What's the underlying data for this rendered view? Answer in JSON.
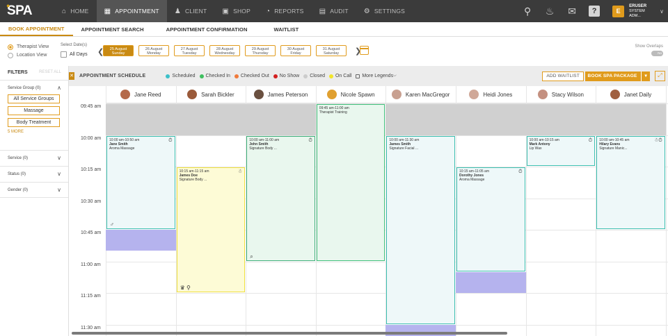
{
  "app": {
    "logo": "SPA"
  },
  "nav": [
    {
      "label": "HOME",
      "icon": "home-icon",
      "glyph": "⌂",
      "active": false
    },
    {
      "label": "APPOINTMENT",
      "icon": "calendar-icon",
      "glyph": "▦",
      "active": true
    },
    {
      "label": "CLIENT",
      "icon": "client-icon",
      "glyph": "♟",
      "active": false
    },
    {
      "label": "SHOP",
      "icon": "shop-icon",
      "glyph": "▣",
      "active": false
    },
    {
      "label": "REPORTS",
      "icon": "reports-icon",
      "glyph": "◔",
      "active": false
    },
    {
      "label": "AUDIT",
      "icon": "audit-icon",
      "glyph": "▤",
      "active": false
    },
    {
      "label": "SETTINGS",
      "icon": "settings-icon",
      "glyph": "⚙",
      "active": false
    }
  ],
  "user": {
    "initial": "E",
    "name": "ERUSER",
    "role": "SYSTEM ADM..."
  },
  "subtabs": [
    "BOOK APPOINTMENT",
    "APPOINTMENT SEARCH",
    "APPOINTMENT CONFIRMATION",
    "WAITLIST"
  ],
  "datebar": {
    "therapist_view": "Therapist View",
    "location_view": "Location View",
    "select_dates": "Select Date(s)",
    "all_days": "All Days",
    "show_overlaps": "Show Overlaps",
    "toggle": "No",
    "dates": [
      {
        "date": "25 August",
        "day": "Sunday",
        "selected": true
      },
      {
        "date": "26 August",
        "day": "Monday",
        "selected": false
      },
      {
        "date": "27 August",
        "day": "Tuesday",
        "selected": false
      },
      {
        "date": "28 August",
        "day": "Wednesday",
        "selected": false
      },
      {
        "date": "29 August",
        "day": "Thursday",
        "selected": false
      },
      {
        "date": "30 August",
        "day": "Friday",
        "selected": false
      },
      {
        "date": "31 August",
        "day": "Saturday",
        "selected": false
      }
    ]
  },
  "filters": {
    "title": "FILTERS",
    "reset": "RESET ALL",
    "service_group": "Service Group (0)",
    "groups": [
      "All Service Groups",
      "Massage",
      "Body Treatment"
    ],
    "more": "5 MORE",
    "service": "Service (0)",
    "status": "Status (0)",
    "gender": "Gender (0)"
  },
  "schedule": {
    "title": "APPOINTMENT SCHEDULE",
    "legend": [
      {
        "label": "Scheduled",
        "color": "#3cc0c9"
      },
      {
        "label": "Checked In",
        "color": "#3fbf5f"
      },
      {
        "label": "Checked Out",
        "color": "#f07a3a"
      },
      {
        "label": "No Show",
        "color": "#d32020"
      },
      {
        "label": "Closed",
        "color": "#cccccc"
      },
      {
        "label": "On Call",
        "color": "#f2e52a"
      }
    ],
    "more_legends": "More Legends",
    "add_waitlist": "ADD WAITLIST",
    "book_package": "BOOK SPA PACKAGE"
  },
  "therapists": [
    {
      "name": "Jane Reed",
      "avatar": "#b46a4a"
    },
    {
      "name": "Sarah Bickler",
      "avatar": "#9a5a3a"
    },
    {
      "name": "James Peterson",
      "avatar": "#6a5040"
    },
    {
      "name": "Nicole Spawn",
      "avatar": "#e0a030"
    },
    {
      "name": "Karen MacGregor",
      "avatar": "#c8a090"
    },
    {
      "name": "Heidi Jones",
      "avatar": "#d0a898"
    },
    {
      "name": "Stacy Wilson",
      "avatar": "#c49080"
    },
    {
      "name": "Janet Daily",
      "avatar": "#a06040"
    }
  ],
  "times": [
    "09:45 am",
    "10:00 am",
    "10:15 am",
    "10:30 am",
    "10:45 am",
    "11:00 am",
    "11:15 am",
    "11:30 am"
  ],
  "appointments": [
    {
      "col": 0,
      "start": 1,
      "span": 3,
      "time": "10:00 am-10:50 am",
      "client": "Jane Smith",
      "service": "Aroma Massage",
      "bg": "#eef8f9",
      "border": "#3dbfb0",
      "icon": "⏱",
      "bottom_icon": "♂"
    },
    {
      "col": 1,
      "start": 2,
      "span": 4,
      "time": "10:15 am-11:15 am",
      "client": "James Doe",
      "service": "Signature Body ...",
      "bg": "#fdfbd6",
      "border": "#f0e040",
      "icon": "☃",
      "bottom_icon": "♛ ⚲"
    },
    {
      "col": 2,
      "start": 1,
      "span": 4,
      "time": "10:00 am-11:00 am",
      "client": "John Smith",
      "service": "Signature Body ...",
      "bg": "#e9f7ee",
      "border": "#3fb07a",
      "icon": "⏱",
      "bottom_icon": "⌕"
    },
    {
      "col": 3,
      "start": 0,
      "span": 5,
      "time": "09:45 am-11:00 am",
      "client": "",
      "service": "Therapist Training",
      "bg": "#e9f7ee",
      "border": "#3fbf7a",
      "icon": "",
      "bottom_icon": ""
    },
    {
      "col": 4,
      "start": 1,
      "span": 6,
      "time": "10:00 am-11:30 am",
      "client": "James Smith",
      "service": "Signature Facial ...",
      "bg": "#eef8f9",
      "border": "#3dbfb0",
      "icon": "",
      "bottom_icon": ""
    },
    {
      "col": 5,
      "start": 2,
      "span": 3.33,
      "time": "10:15 am-11:05 am",
      "client": "Dorothy Jones",
      "service": "Aroma Massage",
      "bg": "#eef8f9",
      "border": "#3dbfb0",
      "icon": "⏱",
      "bottom_icon": ""
    },
    {
      "col": 6,
      "start": 1,
      "span": 1,
      "time": "10:00 am-10:15 am",
      "client": "Mark Antony",
      "service": "Lip Wax",
      "bg": "#eef8f9",
      "border": "#3dbfb0",
      "icon": "⏱",
      "bottom_icon": ""
    },
    {
      "col": 7,
      "start": 1,
      "span": 3,
      "time": "10:00 am-10:45 am",
      "client": "Hilary Evans",
      "service": "Signature Manic...",
      "bg": "#eef8f9",
      "border": "#3dbfb0",
      "icon": "☃⏱",
      "bottom_icon": ""
    }
  ]
}
